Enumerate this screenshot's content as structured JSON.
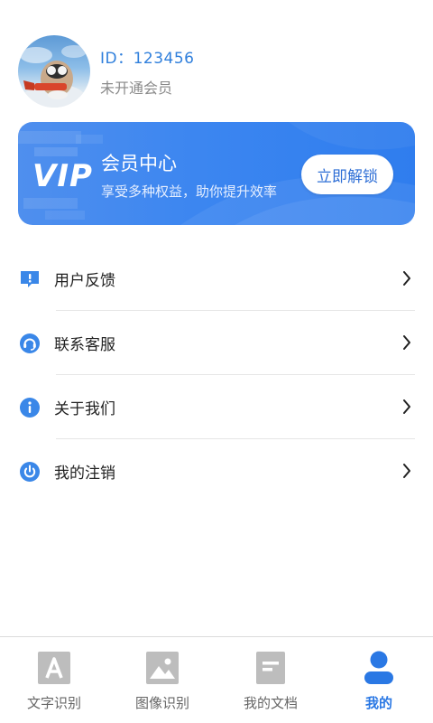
{
  "profile": {
    "user_id": "ID：123456",
    "member_status": "未开通会员"
  },
  "vip": {
    "logo": "VIP",
    "title": "会员中心",
    "subtitle": "享受多种权益，助你提升效率",
    "button_label": "立即解锁"
  },
  "menu": {
    "items": [
      {
        "label": "用户反馈",
        "icon": "feedback-icon"
      },
      {
        "label": "联系客服",
        "icon": "customer-service-icon"
      },
      {
        "label": "关于我们",
        "icon": "info-icon"
      },
      {
        "label": "我的注销",
        "icon": "power-icon"
      }
    ]
  },
  "tabbar": {
    "tabs": [
      {
        "label": "文字识别",
        "icon": "text-recognition-icon",
        "active": false
      },
      {
        "label": "图像识别",
        "icon": "image-recognition-icon",
        "active": false
      },
      {
        "label": "我的文档",
        "icon": "document-icon",
        "active": false
      },
      {
        "label": "我的",
        "icon": "user-icon",
        "active": true
      }
    ]
  },
  "colors": {
    "accent": "#2f7fdc",
    "vip_banner": "#3c86f0",
    "tab_active": "#2a78e4",
    "tab_inactive_icon": "#bdbdbd"
  }
}
